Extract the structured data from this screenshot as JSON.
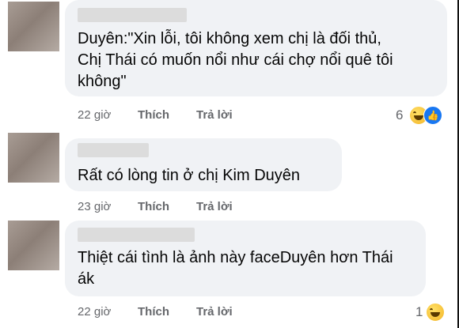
{
  "comments": [
    {
      "text": "Duyên:\"Xin lỗi, tôi không xem chị là đối thủ,\nChị Thái có muốn nổi như cái chợ nổi quê tôi\nkhông\"",
      "time": "22 giờ",
      "like_label": "Thích",
      "reply_label": "Trả lời",
      "reaction_count": "6",
      "reactions": [
        "haha-emoji-icon",
        "like-icon"
      ]
    },
    {
      "text": "Rất có lòng tin ở chị Kim Duyên",
      "time": "23 giờ",
      "like_label": "Thích",
      "reply_label": "Trả lời"
    },
    {
      "text": "Thiệt cái tình là ảnh này faceDuyên hơn Thái\nák",
      "time": "22 giờ",
      "like_label": "Thích",
      "reply_label": "Trả lời",
      "reaction_count": "1",
      "reactions": [
        "haha-emoji-icon"
      ]
    }
  ]
}
